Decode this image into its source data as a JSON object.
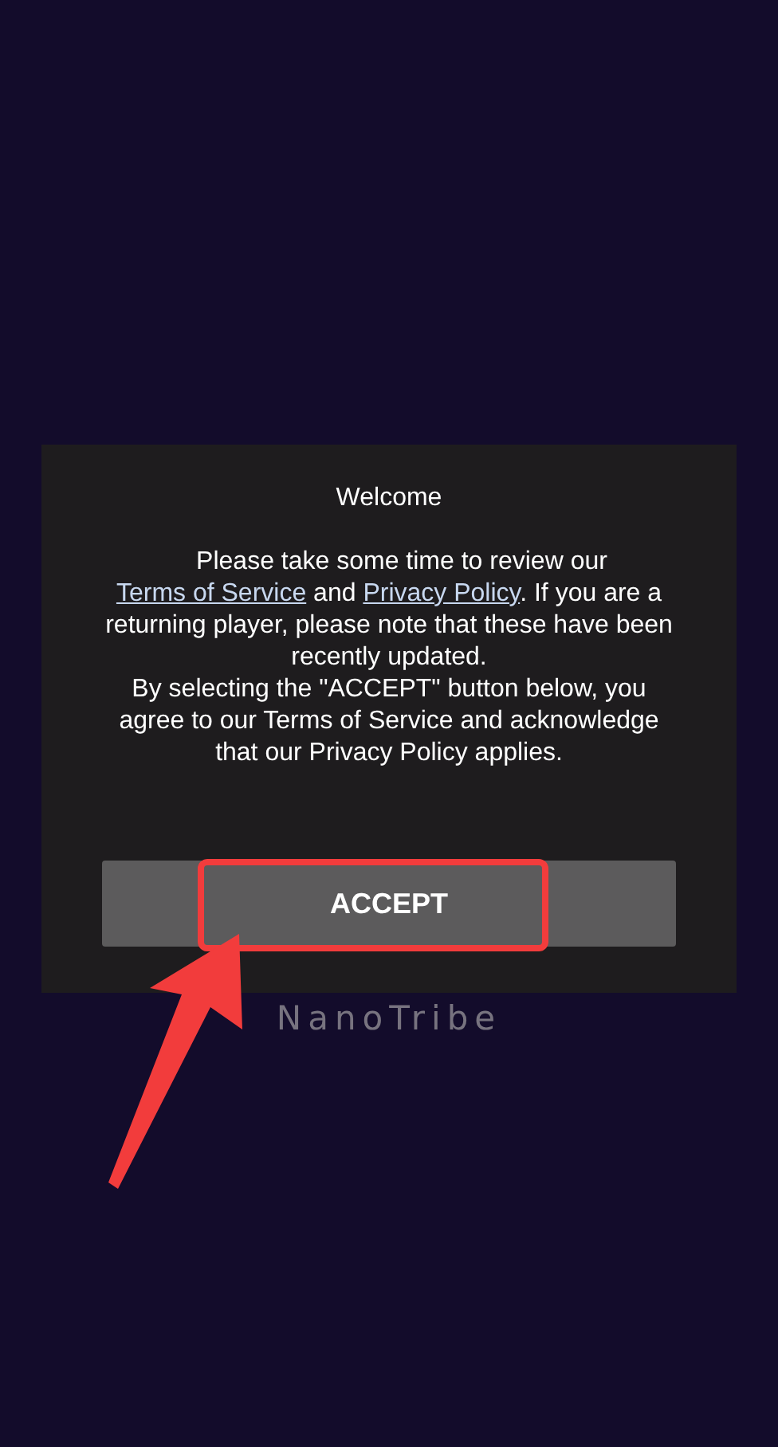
{
  "dialog": {
    "title": "Welcome",
    "message": [
      {
        "text": "Please take some time to review our ",
        "link": false
      },
      {
        "text": "Terms of Service",
        "link": true
      },
      {
        "text": " and ",
        "link": false
      },
      {
        "text": "Privacy Policy",
        "link": true
      },
      {
        "text": ". If you are a returning player, please note that these have been recently updated.",
        "link": false
      }
    ],
    "notice": "By selecting the \"ACCEPT\" button below, you agree to our Terms of Service and acknowledge that our Privacy Policy applies.",
    "button": "ACCEPT"
  },
  "brand": "NanoTribe",
  "annotations": {
    "highlight": true,
    "arrow": true
  }
}
